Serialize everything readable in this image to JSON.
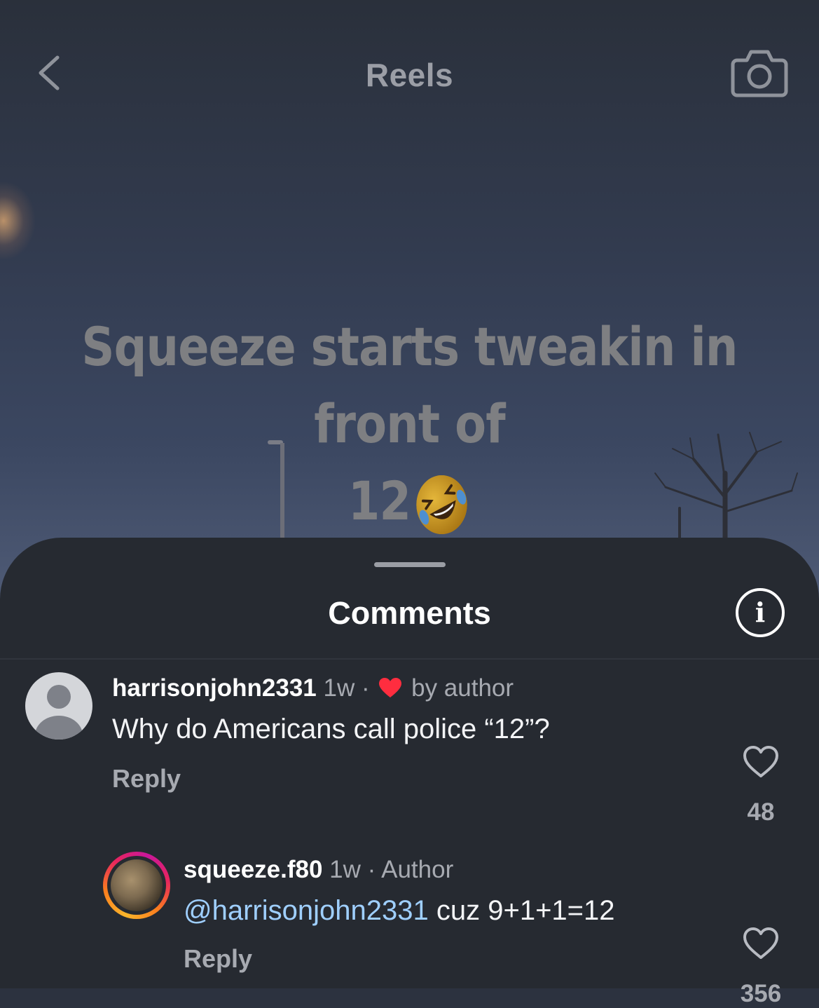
{
  "header": {
    "title": "Reels",
    "back_icon": "chevron-left-icon",
    "camera_icon": "camera-icon"
  },
  "video": {
    "caption_line1": "Squeeze starts tweakin in front of",
    "caption_line2": "12",
    "caption_emoji": "rolling-on-floor-laughing-emoji"
  },
  "comments_sheet": {
    "title": "Comments",
    "info_icon": "info-icon",
    "comments": [
      {
        "username": "harrisonjohn2331",
        "time": "1w",
        "separator": "·",
        "author_like_label": "by author",
        "text": "Why do Americans call police “12”?",
        "reply_label": "Reply",
        "likes": "48"
      },
      {
        "username": "squeeze.f80",
        "time": "1w",
        "separator": "·",
        "role": "Author",
        "mention": "@harrisonjohn2331",
        "text": "cuz 9+1+1=12",
        "reply_label": "Reply",
        "likes": "356"
      }
    ]
  },
  "colors": {
    "sheet_bg": "#262a31",
    "mention": "#9fcfff",
    "author_heart": "#ff2d3f",
    "secondary_text": "#a7aab1"
  }
}
